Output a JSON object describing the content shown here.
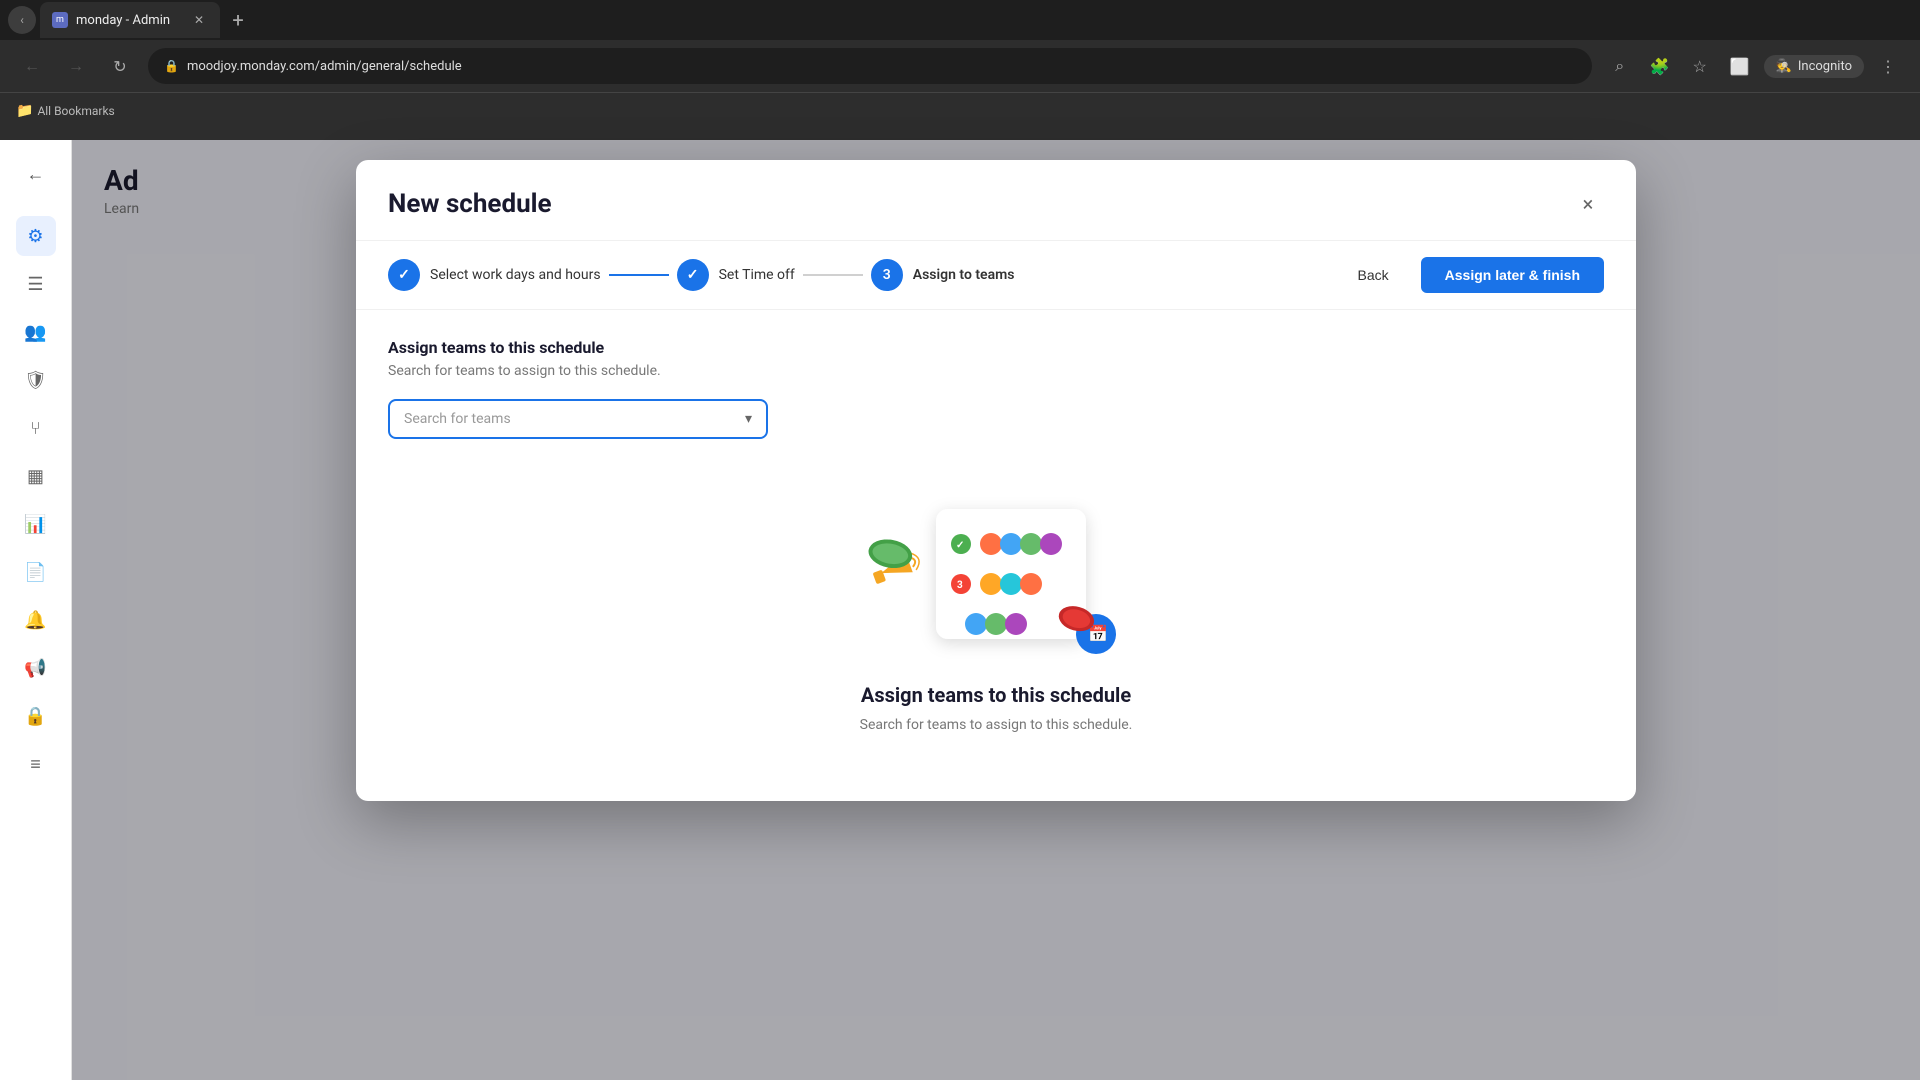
{
  "browser": {
    "tab_title": "monday - Admin",
    "url": "moodjoy.monday.com/admin/general/schedule",
    "incognito_label": "Incognito",
    "bookmarks_label": "All Bookmarks",
    "new_tab_symbol": "+"
  },
  "modal": {
    "title": "New schedule",
    "close_symbol": "×",
    "steps": [
      {
        "id": 1,
        "label": "Select work days and hours",
        "state": "completed"
      },
      {
        "id": 2,
        "label": "Set Time off",
        "state": "completed"
      },
      {
        "id": 3,
        "label": "Assign to teams",
        "state": "active"
      }
    ],
    "back_label": "Back",
    "finish_label": "Assign later & finish",
    "section_title": "Assign teams to this schedule",
    "section_subtitle": "Search for teams to assign to this schedule.",
    "search_placeholder": "Search for teams",
    "illustration_title": "Assign teams to this schedule",
    "illustration_subtitle": "Search for teams to assign to this schedule."
  },
  "sidebar": {
    "back_symbol": "←",
    "page_title": "Ad",
    "page_subtitle": "Learn"
  }
}
